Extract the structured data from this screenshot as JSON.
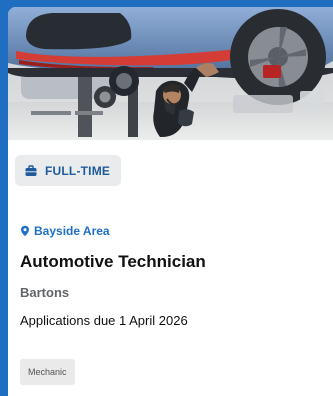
{
  "card": {
    "image": {
      "alt": "Mechanic working under a lifted blue car in a workshop"
    },
    "badge": {
      "icon": "briefcase-icon",
      "label": "FULL-TIME"
    },
    "location": {
      "icon": "location-pin-icon",
      "label": "Bayside Area"
    },
    "title": "Automotive Technician",
    "company": "Bartons",
    "deadline": "Applications due 1 April 2026",
    "tags": [
      "Mechanic"
    ]
  },
  "colors": {
    "page_background": "#1f6ec2",
    "card_background": "#ffffff",
    "badge_text": "#1e5a9c",
    "badge_background": "#e9ebed",
    "location_text": "#1f70c4",
    "title_text": "#111111",
    "company_text": "#62666b",
    "tag_background": "#eaeaea",
    "tag_text": "#545454"
  }
}
